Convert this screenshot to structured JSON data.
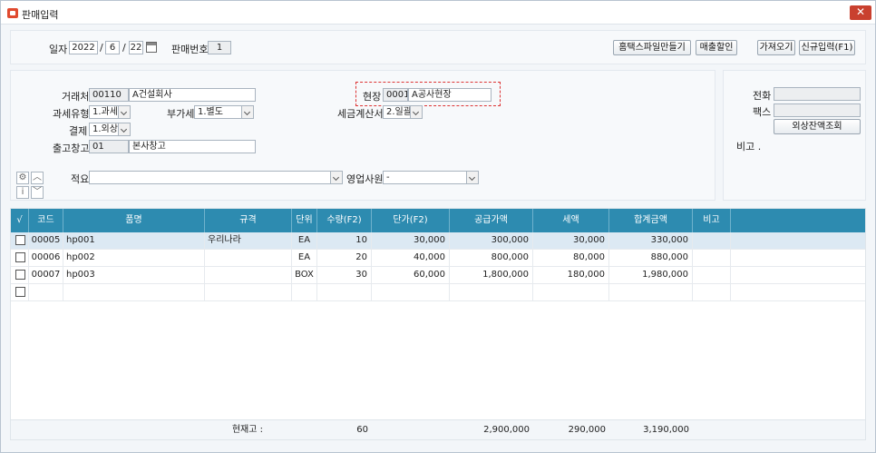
{
  "window": {
    "title": "판매입력",
    "close_label": "✕"
  },
  "top": {
    "date_label": "일자",
    "year": "2022",
    "month": "6",
    "day": "22",
    "slash": "/",
    "sale_no_label": "판매번호",
    "sale_no": "1",
    "buttons": [
      "홈택스파일만들기",
      "매출할인",
      "가져오기",
      "신규입력(F1)"
    ]
  },
  "form": {
    "client_label": "거래처",
    "client_code": "00110",
    "client_name": "A건설회사",
    "tax_type_label": "과세유형",
    "tax_type": "1.과세",
    "vat_label": "부가세",
    "vat": "1.별도",
    "payment_label": "결제",
    "payment": "1.외상",
    "warehouse_label": "출고창고",
    "warehouse_code": "01",
    "warehouse_name": "본사창고",
    "site_label": "현장",
    "site_code": "0001",
    "site_name": "A공사현장",
    "invoice_label": "세금계산서",
    "invoice": "2.일괄",
    "memo_label": "적요",
    "memo": "",
    "sales_rep_label": "영업사원",
    "sales_rep": "-"
  },
  "side": {
    "phone_label": "전화",
    "phone": "",
    "fax_label": "팩스",
    "fax": "",
    "balance_button": "외상잔액조회",
    "note_label": "비고 ."
  },
  "grid": {
    "headers": [
      "√",
      "코드",
      "품명",
      "규격",
      "단위",
      "수량(F2)",
      "단가(F2)",
      "공급가액",
      "세액",
      "합계금액",
      "비고"
    ],
    "rows": [
      {
        "code": "00005",
        "name": "hp001",
        "spec": "우리나라",
        "unit": "EA",
        "qty": "10",
        "price": "30,000",
        "supply": "300,000",
        "tax": "30,000",
        "total": "330,000",
        "note": ""
      },
      {
        "code": "00006",
        "name": "hp002",
        "spec": "",
        "unit": "EA",
        "qty": "20",
        "price": "40,000",
        "supply": "800,000",
        "tax": "80,000",
        "total": "880,000",
        "note": ""
      },
      {
        "code": "00007",
        "name": "hp003",
        "spec": "",
        "unit": "BOX",
        "qty": "30",
        "price": "60,000",
        "supply": "1,800,000",
        "tax": "180,000",
        "total": "1,980,000",
        "note": ""
      }
    ],
    "footer": {
      "label": "현재고 :",
      "qty": "60",
      "supply": "2,900,000",
      "tax": "290,000",
      "total": "3,190,000"
    }
  },
  "icons": {
    "settings": "gear-icon",
    "info": "info-icon",
    "up": "chevron-up-icon",
    "down": "chevron-down-icon"
  }
}
